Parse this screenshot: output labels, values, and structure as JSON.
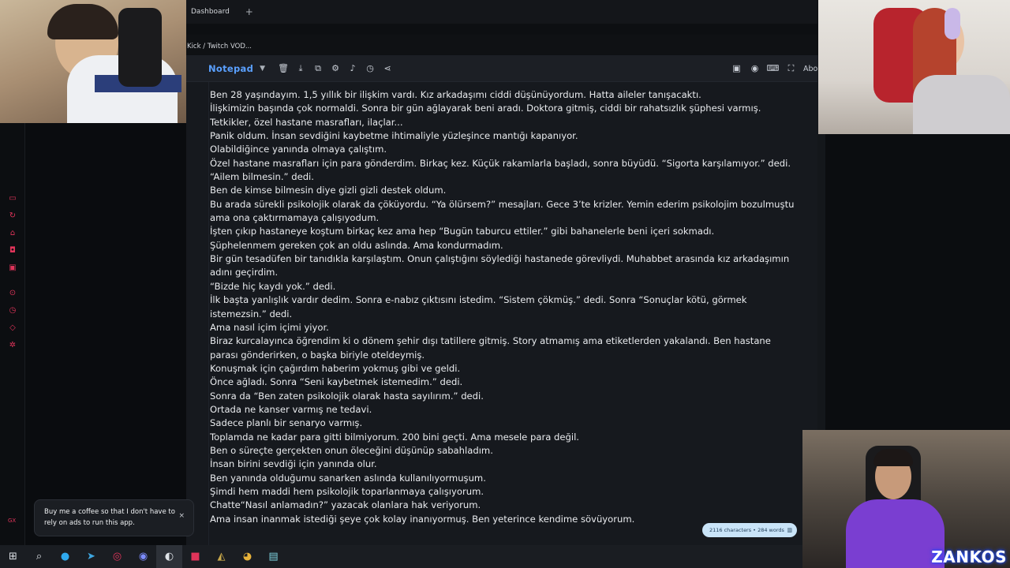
{
  "browser": {
    "tab_label": "Dashboard",
    "new_tab_icon": "plus-icon",
    "address_text": "Kick / Twitch VOD..."
  },
  "notepad": {
    "brand": "Notepad",
    "toolbar_icons": [
      "trash-icon",
      "download-icon",
      "copy-icon",
      "gear-icon",
      "music-icon",
      "history-icon",
      "share-icon"
    ],
    "right_icons": [
      "save-icon",
      "record-icon",
      "keyboard-icon",
      "fullscreen-icon"
    ],
    "about_label": "About",
    "lines": [
      "Ben 28 yaşındayım. 1,5 yıllık bir ilişkim vardı. Kız arkadaşımı ciddi düşünüyordum. Hatta aileler tanışacaktı.",
      "İlişkimizin başında çok normaldi. Sonra bir gün ağlayarak beni aradı. Doktora gitmiş, ciddi bir rahatsızlık şüphesi varmış. Tetkikler, özel hastane masrafları, ilaçlar...",
      "Panik oldum. İnsan sevdiğini kaybetme ihtimaliyle yüzleşince mantığı kapanıyor.",
      "Olabildiğince yanında olmaya çalıştım.",
      "Özel hastane masrafları için para gönderdim. Birkaç kez. Küçük rakamlarla başladı, sonra büyüdü. “Sigorta karşılamıyor.” dedi. “Ailem bilmesin.” dedi.",
      "Ben de kimse bilmesin diye gizli gizli destek oldum.",
      "Bu arada sürekli psikolojik olarak da çöküyordu. “Ya ölürsem?” mesajları. Gece 3’te krizler. Yemin ederim psikolojim bozulmuştu ama ona çaktırmamaya çalışıyodum.",
      "İşten çıkıp hastaneye koştum birkaç kez ama hep “Bugün taburcu ettiler.” gibi bahanelerle beni içeri sokmadı.",
      "Şüphelenmem gereken çok an oldu aslında. Ama kondurmadım.",
      "Bir gün tesadüfen bir tanıdıkla karşılaştım. Onun çalıştığını söylediği hastanede görevliydi. Muhabbet arasında kız arkadaşımın adını geçirdim.",
      "“Bizde hiç kaydı yok.” dedi.",
      "İlk başta yanlışlık vardır dedim. Sonra e-nabız çıktısını istedim. “Sistem çökmüş.” dedi. Sonra “Sonuçlar kötü, görmek istemezsin.” dedi.",
      "Ama nasıl içim içimi yiyor.",
      "Biraz kurcalayınca öğrendim ki o dönem şehir dışı tatillere gitmiş. Story atmamış ama etiketlerden yakalandı. Ben hastane parası gönderirken, o başka biriyle oteldeymiş.",
      "Konuşmak için çağırdım haberim yokmuş gibi ve geldi.",
      "Önce ağladı. Sonra “Seni kaybetmek istemedim.” dedi.",
      "Sonra da “Ben zaten psikolojik olarak hasta sayılırım.” dedi.",
      "Ortada ne kanser varmış ne tedavi.",
      "Sadece planlı bir senaryo varmış.",
      "Toplamda ne kadar para gitti bilmiyorum. 200 bini geçti. Ama mesele para değil.",
      "Ben o süreçte gerçekten onun öleceğini düşünüp sabahladım.",
      "İnsan birini sevdiği için yanında olur.",
      "Ben yanında olduğumu sanarken aslında kullanılıyormuşum.",
      "Şimdi hem maddi hem psikolojik toparlanmaya çalışıyorum.",
      "Chatte“Nasıl anlamadın?” yazacak olanlara hak veriyorum.",
      "Ama insan inanmak istediği şeye çok kolay inanıyormuş. Ben yeterince kendime sövüyorum."
    ],
    "counter": "2116 characters • 284 words"
  },
  "toast": {
    "text": "Buy me a coffee so that I don't have to rely on ads to run this app.",
    "close": "×"
  },
  "sidebar": {
    "gx_label": "GX",
    "icons": [
      "window-icon",
      "refresh-icon",
      "bot-icon",
      "gamepad-icon",
      "kick-icon",
      "play-icon",
      "clock-icon",
      "puzzle-icon",
      "settings-icon"
    ]
  },
  "overlay": {
    "streamer_tag": "ZANKOS"
  },
  "taskbar": {
    "icons": [
      "windows-start-icon",
      "search-icon",
      "edge-icon",
      "telegram-icon",
      "opera-gx-icon",
      "discord-icon",
      "obs-icon",
      "app-red-icon",
      "league-icon",
      "chrome-icon",
      "notepad-icon"
    ]
  },
  "colors": {
    "accent": "#5aa0ff",
    "sidebar_icon": "#e0345a",
    "editor_bg": "#16191e"
  }
}
